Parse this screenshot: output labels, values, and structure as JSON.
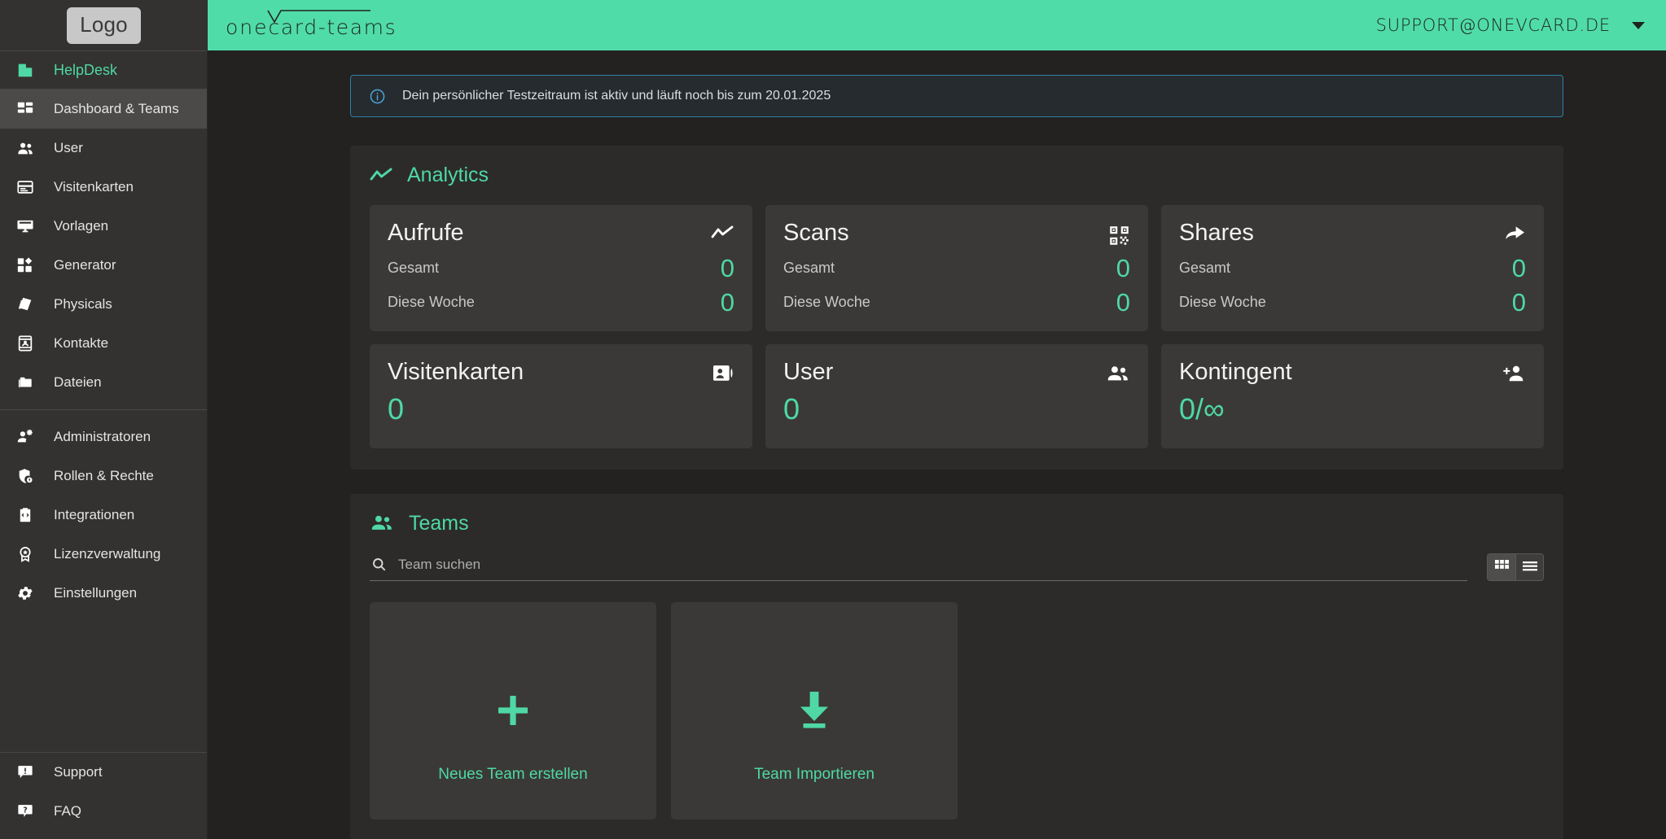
{
  "sidebar": {
    "logo_label": "Logo",
    "helpdesk": {
      "label": "HelpDesk",
      "icon": "building-icon"
    },
    "items": [
      {
        "label": "Dashboard & Teams",
        "icon": "dashboard-icon",
        "active": true
      },
      {
        "label": "User",
        "icon": "users-icon",
        "active": false
      },
      {
        "label": "Visitenkarten",
        "icon": "card-icon",
        "active": false
      },
      {
        "label": "Vorlagen",
        "icon": "template-icon",
        "active": false
      },
      {
        "label": "Generator",
        "icon": "generator-icon",
        "active": false
      },
      {
        "label": "Physicals",
        "icon": "physicals-icon",
        "active": false
      },
      {
        "label": "Kontakte",
        "icon": "contacts-icon",
        "active": false
      },
      {
        "label": "Dateien",
        "icon": "folder-icon",
        "active": false
      }
    ],
    "items2": [
      {
        "label": "Administratoren",
        "icon": "admin-user-icon"
      },
      {
        "label": "Rollen & Rechte",
        "icon": "shield-icon"
      },
      {
        "label": "Integrationen",
        "icon": "code-box-icon"
      },
      {
        "label": "Lizenzverwaltung",
        "icon": "award-icon"
      },
      {
        "label": "Einstellungen",
        "icon": "gear-icon"
      }
    ],
    "bottom": [
      {
        "label": "Support",
        "icon": "support-bubble-icon"
      },
      {
        "label": "FAQ",
        "icon": "question-bubble-icon"
      }
    ]
  },
  "topbar": {
    "brand_one": "one",
    "brand_card": "card",
    "brand_suffix": "-teams",
    "account": "SUPPORT@ONEVCARD.DE",
    "caret_icon": "chevron-down-icon"
  },
  "banner": {
    "icon": "info-icon",
    "text": "Dein persönlicher Testzeitraum ist aktiv und läuft noch bis zum 20.01.2025"
  },
  "analytics": {
    "title": "Analytics",
    "icon": "trend-line-icon",
    "row1": [
      {
        "title": "Aufrufe",
        "icon": "trend-line-icon",
        "rows": [
          {
            "label": "Gesamt",
            "value": "0"
          },
          {
            "label": "Diese Woche",
            "value": "0"
          }
        ]
      },
      {
        "title": "Scans",
        "icon": "qr-code-icon",
        "rows": [
          {
            "label": "Gesamt",
            "value": "0"
          },
          {
            "label": "Diese Woche",
            "value": "0"
          }
        ]
      },
      {
        "title": "Shares",
        "icon": "share-arrow-icon",
        "rows": [
          {
            "label": "Gesamt",
            "value": "0"
          },
          {
            "label": "Diese Woche",
            "value": "0"
          }
        ]
      }
    ],
    "row2": [
      {
        "title": "Visitenkarten",
        "icon": "contact-card-icon",
        "value": "0"
      },
      {
        "title": "User",
        "icon": "users-icon",
        "value": "0"
      },
      {
        "title": "Kontingent",
        "icon": "person-add-icon",
        "value": "0/∞"
      }
    ]
  },
  "teams": {
    "title": "Teams",
    "icon": "users-icon",
    "search_placeholder": "Team suchen",
    "search_value": "",
    "search_icon": "search-icon",
    "view_grid_icon": "grid-view-icon",
    "view_list_icon": "list-view-icon",
    "active_view": "grid",
    "cards": [
      {
        "label": "Neues Team erstellen",
        "icon": "plus-icon"
      },
      {
        "label": "Team Importieren",
        "icon": "download-icon"
      }
    ]
  },
  "colors": {
    "accent": "#4fd8a5",
    "header": "#50dca9",
    "sidebar": "#333230",
    "page_bg": "#232221",
    "panel": "#2c2b2a",
    "card": "#3a3937",
    "info_border": "#2f7fa8"
  }
}
